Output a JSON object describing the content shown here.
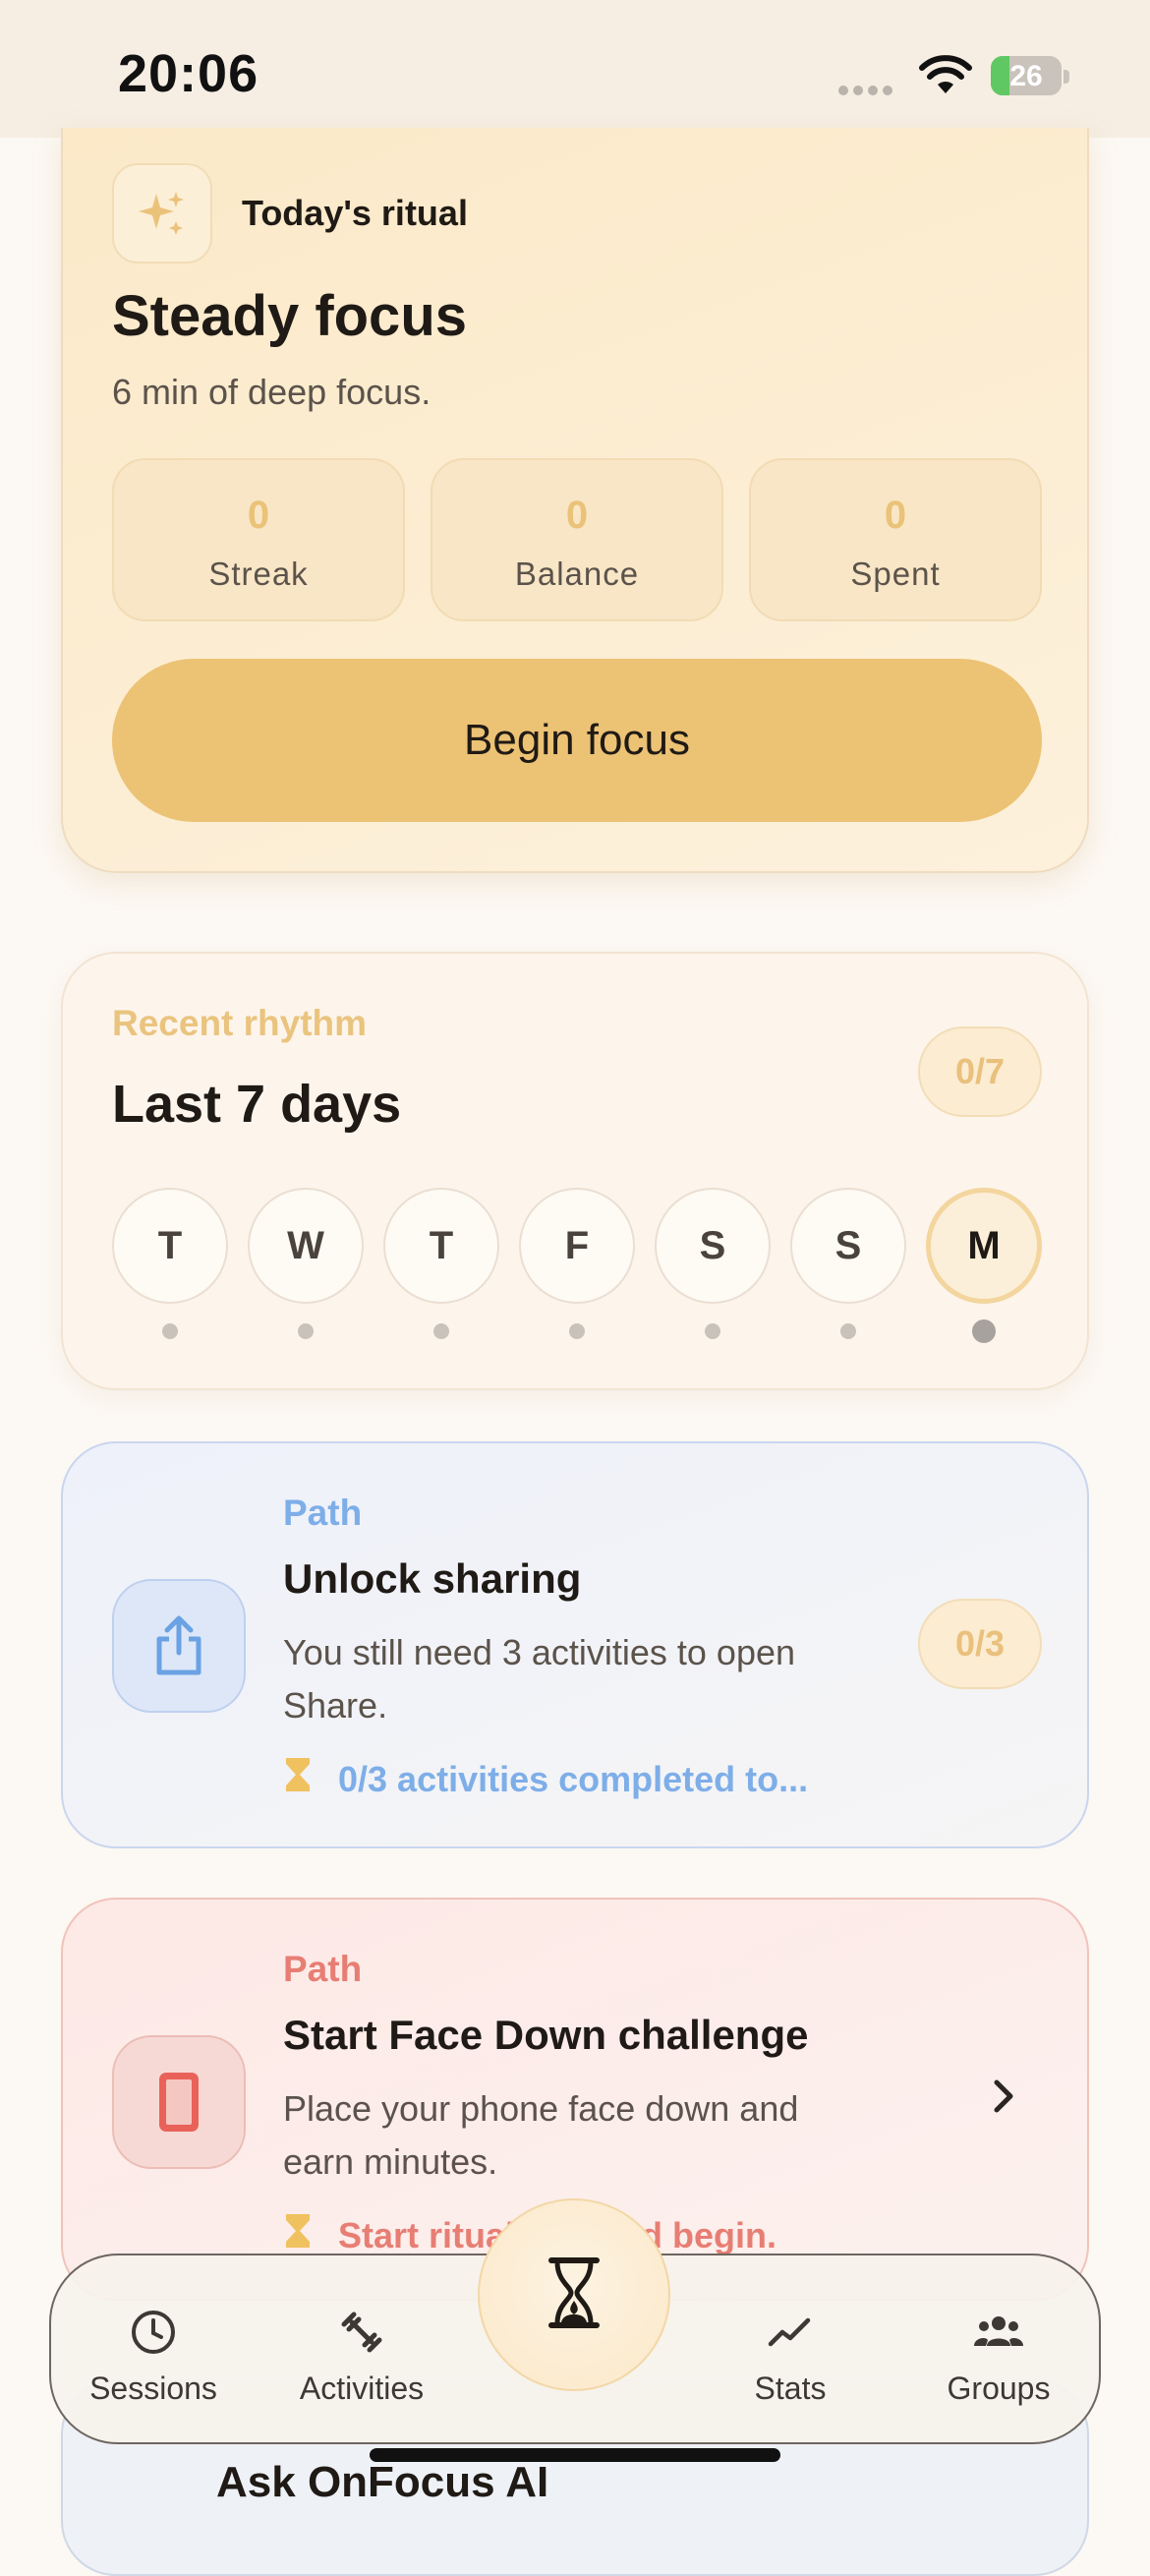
{
  "status": {
    "time": "20:06",
    "battery": "26",
    "battery_level": 0.26
  },
  "ritual": {
    "kicker": "Today's ritual",
    "title": "Steady focus",
    "subtitle": "6 min of deep focus.",
    "stats": [
      {
        "value": "0",
        "label": "Streak"
      },
      {
        "value": "0",
        "label": "Balance"
      },
      {
        "value": "0",
        "label": "Spent"
      }
    ],
    "cta": "Begin focus"
  },
  "rhythm": {
    "kicker": "Recent rhythm",
    "title": "Last 7 days",
    "count": "0/7",
    "days": [
      "T",
      "W",
      "T",
      "F",
      "S",
      "S",
      "M"
    ]
  },
  "paths": [
    {
      "kicker": "Path",
      "title": "Unlock sharing",
      "desc": "You still need 3 activities to open Share.",
      "footer": "0/3 activities completed to...",
      "badge": "0/3",
      "icon": "share-icon",
      "accent": "#7eaee8"
    },
    {
      "kicker": "Path",
      "title": "Start Face Down challenge",
      "desc": "Place your phone face down and earn minutes.",
      "footer": "Start ritual: flip and begin.",
      "icon": "phone-icon",
      "accent": "#e77e74"
    }
  ],
  "peek_title": "Ask OnFocus AI",
  "tabs": [
    {
      "label": "Sessions",
      "icon": "clock-icon"
    },
    {
      "label": "Activities",
      "icon": "dumbbell-icon"
    },
    {
      "label": "",
      "icon": "hourglass-icon"
    },
    {
      "label": "Stats",
      "icon": "chart-line-icon"
    },
    {
      "label": "Groups",
      "icon": "people-icon"
    }
  ]
}
